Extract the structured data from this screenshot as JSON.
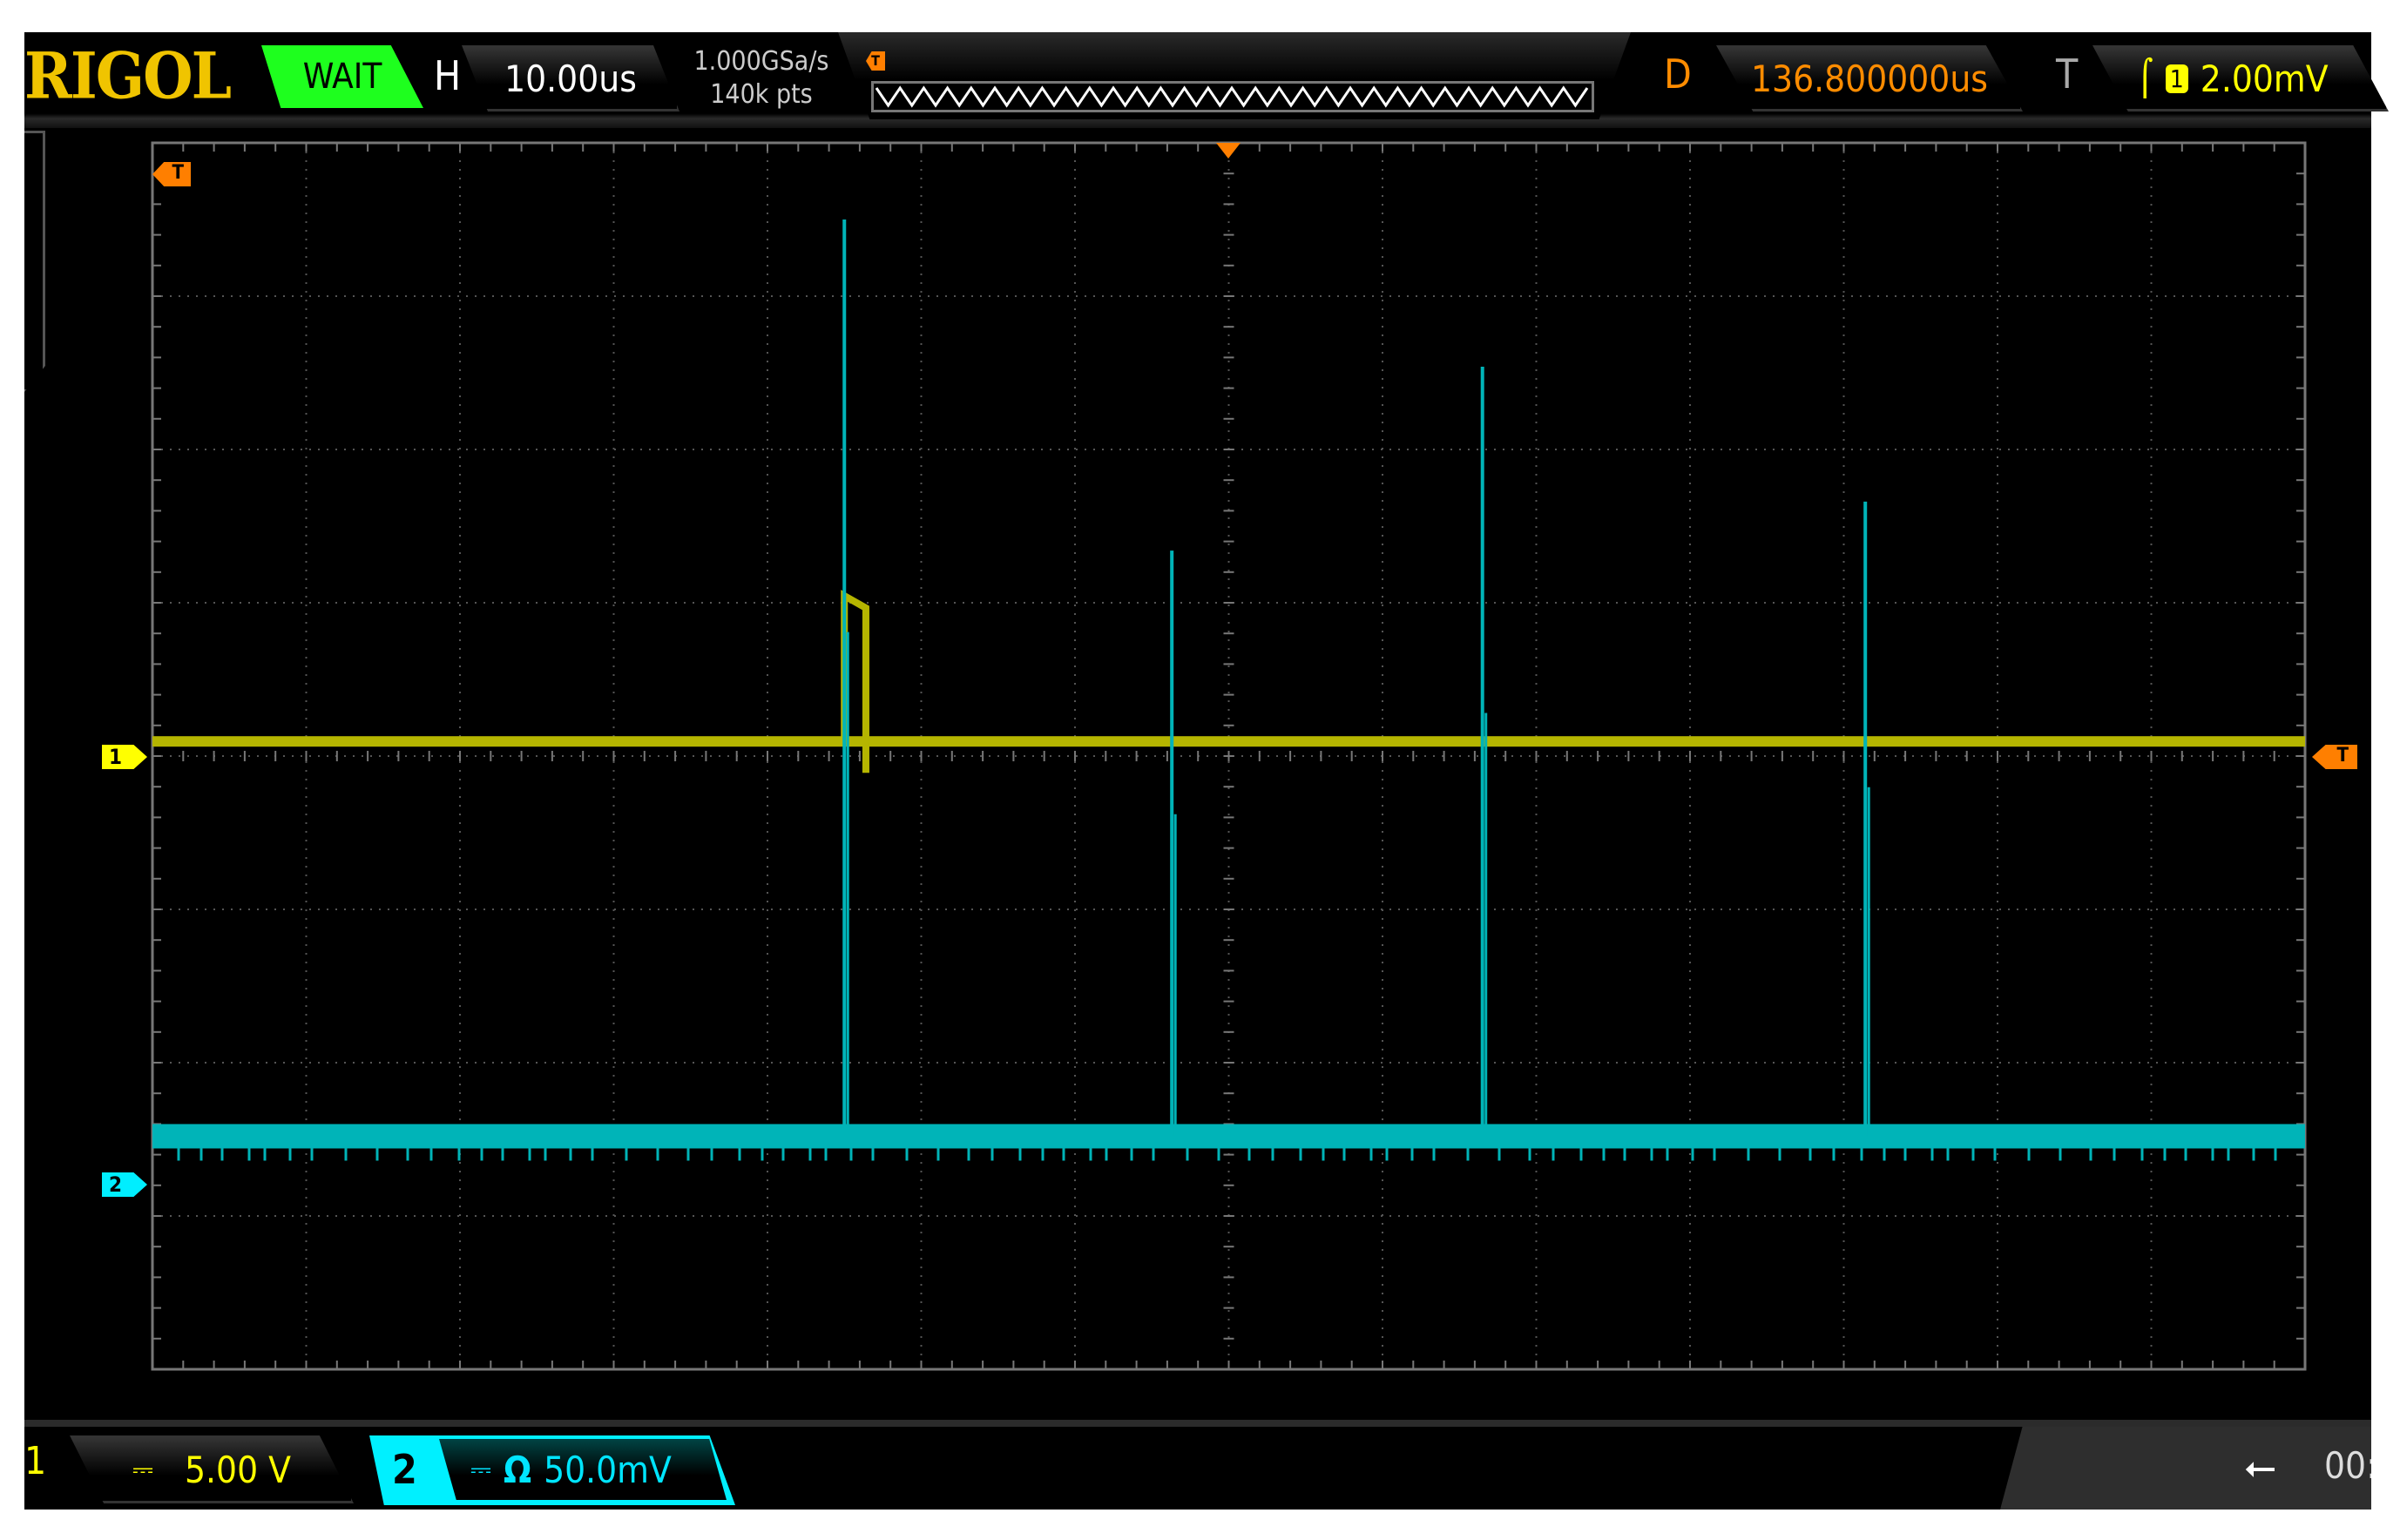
{
  "header": {
    "brand": "RIGOL",
    "run_status": "WAIT",
    "horizontal_label": "H",
    "timebase": "10.00us",
    "sample_rate": "1.000GSa/s",
    "memory_depth": "140k pts",
    "delay_label": "D",
    "delay_value": "136.800000us",
    "trigger_label": "T",
    "trigger_source": "1",
    "trigger_level": "2.00mV"
  },
  "markers": {
    "ch1": "1",
    "ch2": "2",
    "trigger": "T"
  },
  "footer": {
    "ch1_label": "1",
    "ch1_coupling": "⎓",
    "ch1_scale": "5.00 V",
    "ch2_label": "2",
    "ch2_coupling": "⎓",
    "ch2_impedance": "Ω",
    "ch2_scale": "50.0mV",
    "usb_status": "00:"
  },
  "colors": {
    "ch1": "#b5b500",
    "ch2": "#00b4b8",
    "trigger": "#ff7f00",
    "grid": "#555555"
  },
  "waveforms": {
    "time_per_div_us": 10,
    "divisions": [
      14,
      8
    ],
    "ch1": {
      "volts_per_div": 5,
      "baseline_div": 0.05,
      "pulse": {
        "start_us": -25.0,
        "end_us": -23.6,
        "amplitude_v": 5
      }
    },
    "ch2": {
      "mv_per_div": 50,
      "baseline_div": -2.48,
      "spikes": [
        {
          "t_us": -25.0,
          "mv": 299
        },
        {
          "t_us": -3.7,
          "mv": 191
        },
        {
          "t_us": 16.5,
          "mv": 251
        },
        {
          "t_us": 41.4,
          "mv": 207
        }
      ]
    }
  }
}
